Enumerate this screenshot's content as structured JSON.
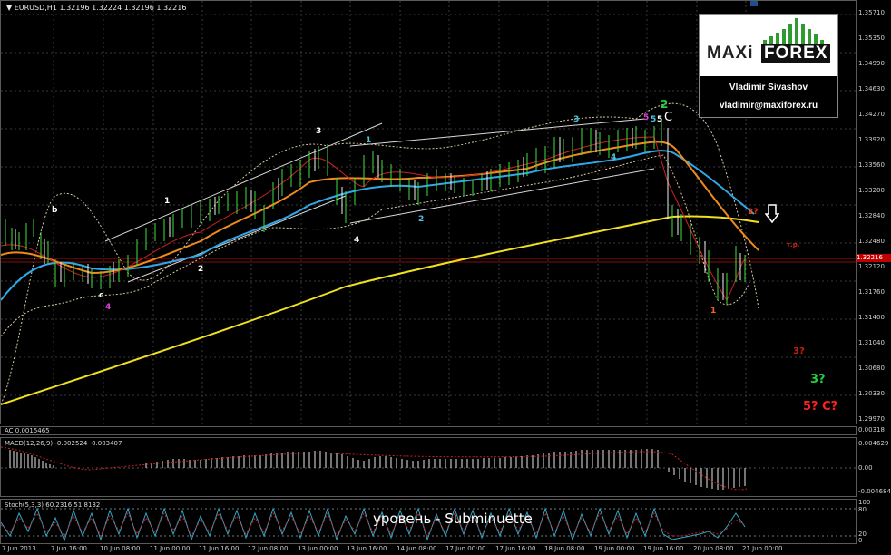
{
  "header": {
    "symbol_info": "▼ EURUSD,H1  1.32196  1.32224  1.32196  1.32216"
  },
  "branding": {
    "logo_left": "MAXi",
    "logo_right": "FOREX",
    "author": "Vladimir Sivashov",
    "email": "vladimir@maxiforex.ru"
  },
  "price_axis": [
    "1.35710",
    "1.35350",
    "1.34990",
    "1.34630",
    "1.34270",
    "1.33920",
    "1.33560",
    "1.33200",
    "1.32840",
    "1.32480",
    "1.32120",
    "1.31760",
    "1.31400",
    "1.31040",
    "1.30680",
    "1.30330",
    "1.29970"
  ],
  "current_price": "1.32216",
  "time_axis": [
    "7 Jun 2013",
    "7 Jun 16:00",
    "10 Jun 08:00",
    "11 Jun 00:00",
    "11 Jun 16:00",
    "12 Jun 08:00",
    "13 Jun 00:00",
    "13 Jun 16:00",
    "14 Jun 08:00",
    "17 Jun 00:00",
    "17 Jun 16:00",
    "18 Jun 08:00",
    "19 Jun 00:00",
    "19 Jun 16:00",
    "20 Jun 08:00",
    "21 Jun 00:00"
  ],
  "ac_panel": {
    "label": "AC 0.0015465",
    "axis": [
      "0.00318"
    ]
  },
  "macd_panel": {
    "label": "MACD(12,26,9) -0.002524 -0.003407",
    "axis": [
      "0.004629",
      "0.00",
      "-0.004684"
    ]
  },
  "stoch_panel": {
    "label": "Stoch(5,3,3) 60.2316 51.8132",
    "axis": [
      "100",
      "80",
      "20",
      "0"
    ]
  },
  "overlay_text": "уровень - Subminuette",
  "wave_labels": [
    {
      "text": "b",
      "color": "#ffffff"
    },
    {
      "text": "c",
      "color": "#ffffff"
    },
    {
      "text": "4",
      "color": "#e040e0"
    },
    {
      "text": "1",
      "color": "#ffffff"
    },
    {
      "text": "2",
      "color": "#ffffff"
    },
    {
      "text": "3",
      "color": "#ffffff"
    },
    {
      "text": "4",
      "color": "#ffffff"
    },
    {
      "text": "1",
      "color": "#4fc3e0"
    },
    {
      "text": "2",
      "color": "#4fc3e0"
    },
    {
      "text": "3",
      "color": "#4fc3e0"
    },
    {
      "text": "4",
      "color": "#4fc3e0"
    },
    {
      "text": "5",
      "color": "#e040e0"
    },
    {
      "text": "5",
      "color": "#4fc3e0"
    },
    {
      "text": "5",
      "color": "#ffffff"
    },
    {
      "text": "C",
      "color": "#ffffff"
    },
    {
      "text": "2",
      "color": "#22d040"
    },
    {
      "text": "1",
      "color": "#ff6020"
    },
    {
      "text": "2?",
      "color": "#ff3000"
    },
    {
      "text": "3?",
      "color": "#d02000"
    },
    {
      "text": "3?",
      "color": "#22d040"
    },
    {
      "text": "5? C?",
      "color": "#ff2020"
    },
    {
      "text": "т.р.",
      "color": "#d02020"
    }
  ]
}
